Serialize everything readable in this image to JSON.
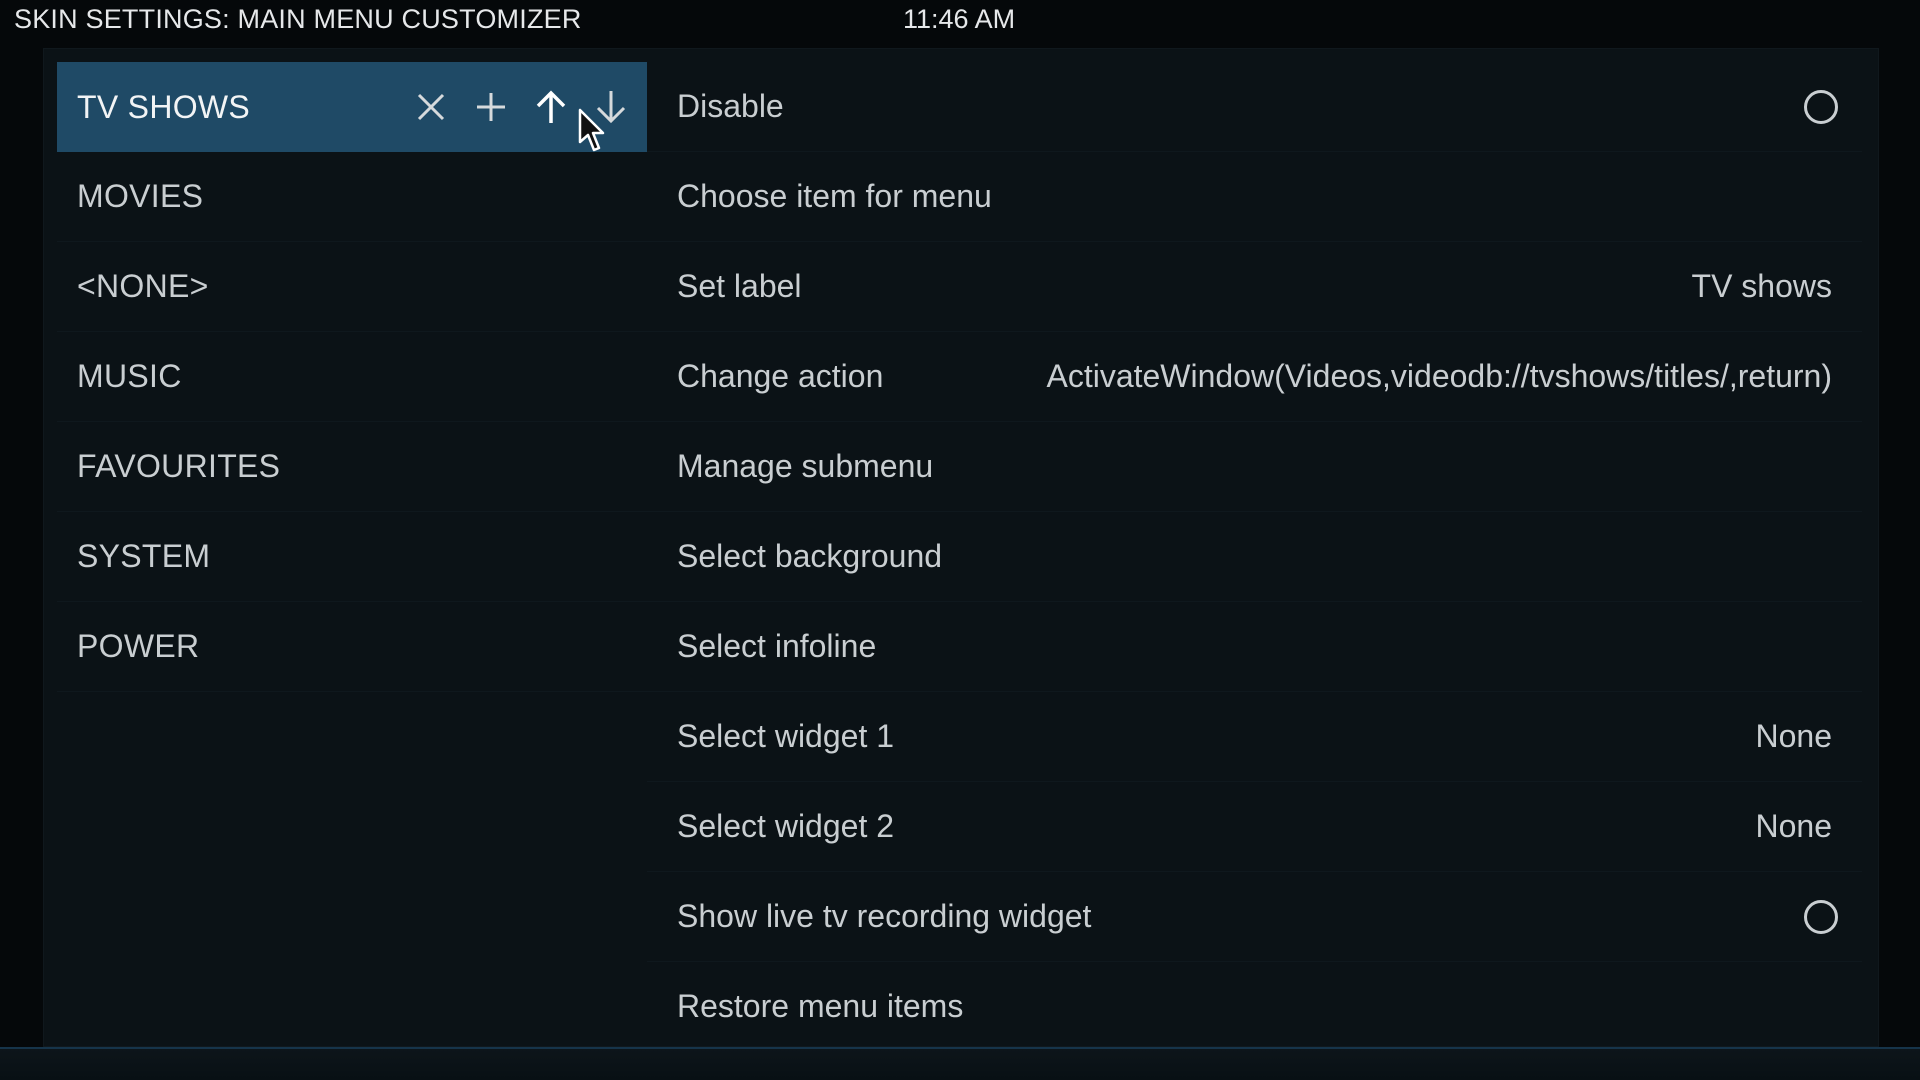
{
  "header": {
    "title": "SKIN SETTINGS: MAIN MENU CUSTOMIZER",
    "clock": "11:46 AM"
  },
  "menu": {
    "items": [
      {
        "label": "TV SHOWS",
        "selected": true
      },
      {
        "label": "MOVIES"
      },
      {
        "label": "<NONE>"
      },
      {
        "label": "MUSIC"
      },
      {
        "label": "FAVOURITES"
      },
      {
        "label": "SYSTEM"
      },
      {
        "label": "POWER"
      }
    ],
    "controls": [
      "close-icon",
      "plus-icon",
      "arrow-up-icon",
      "arrow-down-icon"
    ]
  },
  "options": [
    {
      "label": "Disable",
      "type": "radio",
      "checked": false
    },
    {
      "label": "Choose item for menu"
    },
    {
      "label": "Set label",
      "value": "TV shows"
    },
    {
      "label": "Change action",
      "value": "ActivateWindow(Videos,videodb://tvshows/titles/,return)"
    },
    {
      "label": "Manage submenu"
    },
    {
      "label": "Select background"
    },
    {
      "label": "Select infoline"
    },
    {
      "label": "Select widget 1",
      "value": "None"
    },
    {
      "label": "Select widget 2",
      "value": "None"
    },
    {
      "label": "Show live tv recording widget",
      "type": "radio",
      "checked": false
    },
    {
      "label": "Restore menu items"
    }
  ],
  "colors": {
    "background": "#05080a",
    "panel": "#0b1216",
    "selected": "#1f4a66",
    "text": "#c9ced1"
  }
}
